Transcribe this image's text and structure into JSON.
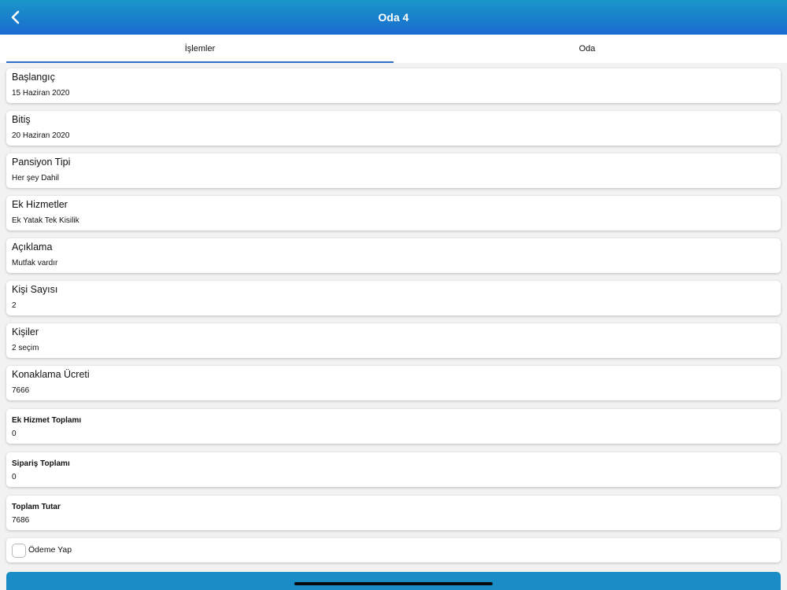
{
  "header": {
    "title": "Oda 4",
    "back_icon": "chevron-left-icon"
  },
  "tabs": [
    {
      "label": "İşlemler",
      "selected": true
    },
    {
      "label": "Oda",
      "selected": false
    }
  ],
  "fields": [
    {
      "label": "Başlangıç",
      "value": "15 Haziran 2020"
    },
    {
      "label": "Bitiş",
      "value": "20 Haziran 2020"
    },
    {
      "label": "Pansiyon Tipi",
      "value": "Her şey Dahil"
    },
    {
      "label": "Ek Hizmetler",
      "value": "Ek Yatak Tek Kisilik"
    },
    {
      "label": "Açıklama",
      "value": "Mutfak vardır"
    },
    {
      "label": "Kişi Sayısı",
      "value": "2"
    },
    {
      "label": "Kişiler",
      "value": "2 seçim"
    },
    {
      "label": "Konaklama Ücreti",
      "value": "7666"
    }
  ],
  "totals": [
    {
      "label": "Ek Hizmet Toplamı",
      "value": "0"
    },
    {
      "label": "Sipariş Toplamı",
      "value": "0"
    },
    {
      "label": "Toplam Tutar",
      "value": "7686"
    }
  ],
  "payment": {
    "checkbox_label": "Ödeme Yap",
    "checked": false
  },
  "colors": {
    "header_gradient_top": "#1a97c8",
    "header_gradient_bottom": "#1a6bd0",
    "tab_indicator": "#2f6fc8",
    "background": "#f2f2f2",
    "action_bar": "#1a8dc6"
  }
}
